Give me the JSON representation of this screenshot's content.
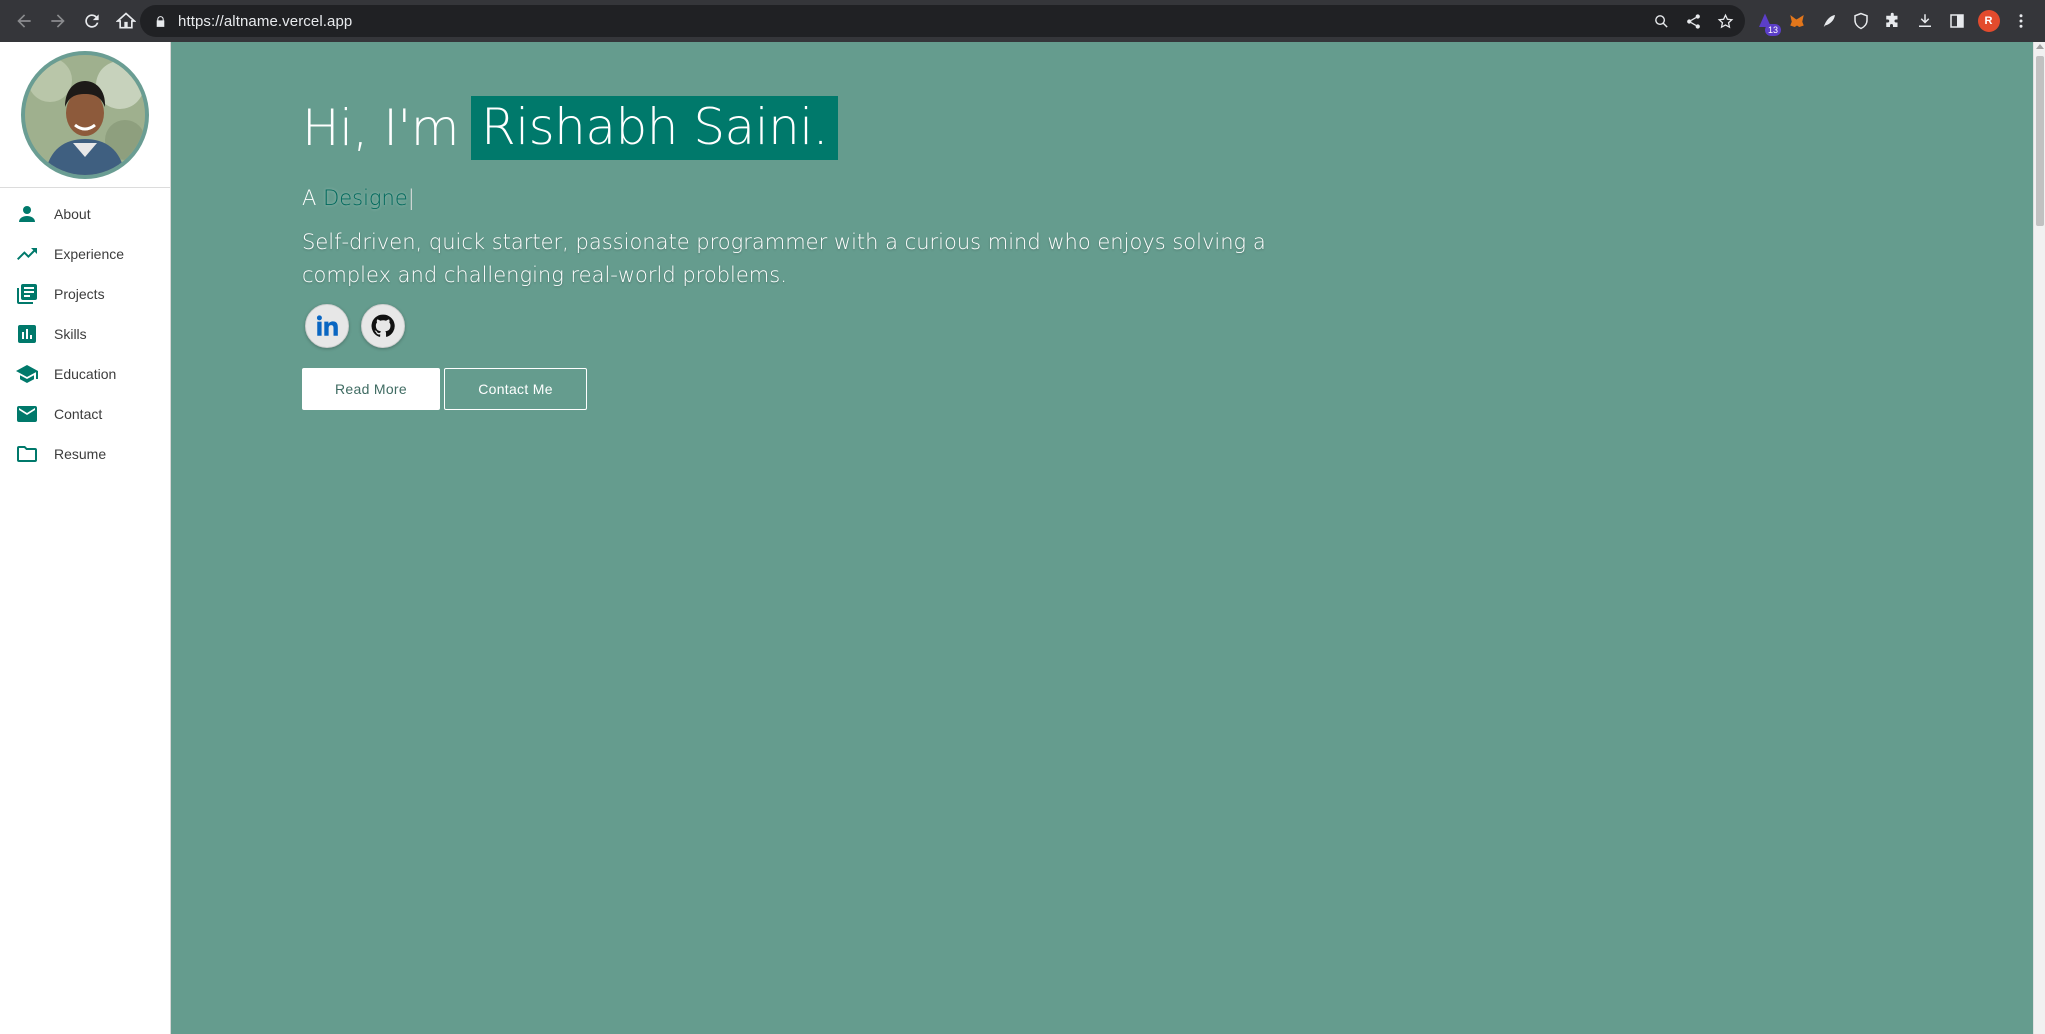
{
  "browser": {
    "url": "https://altname.vercel.app",
    "extension_badge": "13",
    "profile_initial": "R"
  },
  "sidebar": {
    "items": [
      {
        "label": "About",
        "icon": "person-icon"
      },
      {
        "label": "Experience",
        "icon": "trending-up-icon"
      },
      {
        "label": "Projects",
        "icon": "library-books-icon"
      },
      {
        "label": "Skills",
        "icon": "bar-chart-icon"
      },
      {
        "label": "Education",
        "icon": "school-icon"
      },
      {
        "label": "Contact",
        "icon": "mail-icon"
      },
      {
        "label": "Resume",
        "icon": "folder-icon"
      }
    ]
  },
  "hero": {
    "greeting": "Hi, I'm",
    "name": "Rishabh Saini.",
    "role_prefix": "A",
    "role_typed": "Designe",
    "cursor": "|",
    "tagline": "Self-driven, quick starter, passionate programmer with a curious mind who enjoys solving a complex and challenging real-world problems.",
    "read_more": "Read More",
    "contact_me": "Contact Me"
  },
  "colors": {
    "main_bg": "#659c8e",
    "accent": "#00796b",
    "chrome_bg": "#35363a"
  }
}
